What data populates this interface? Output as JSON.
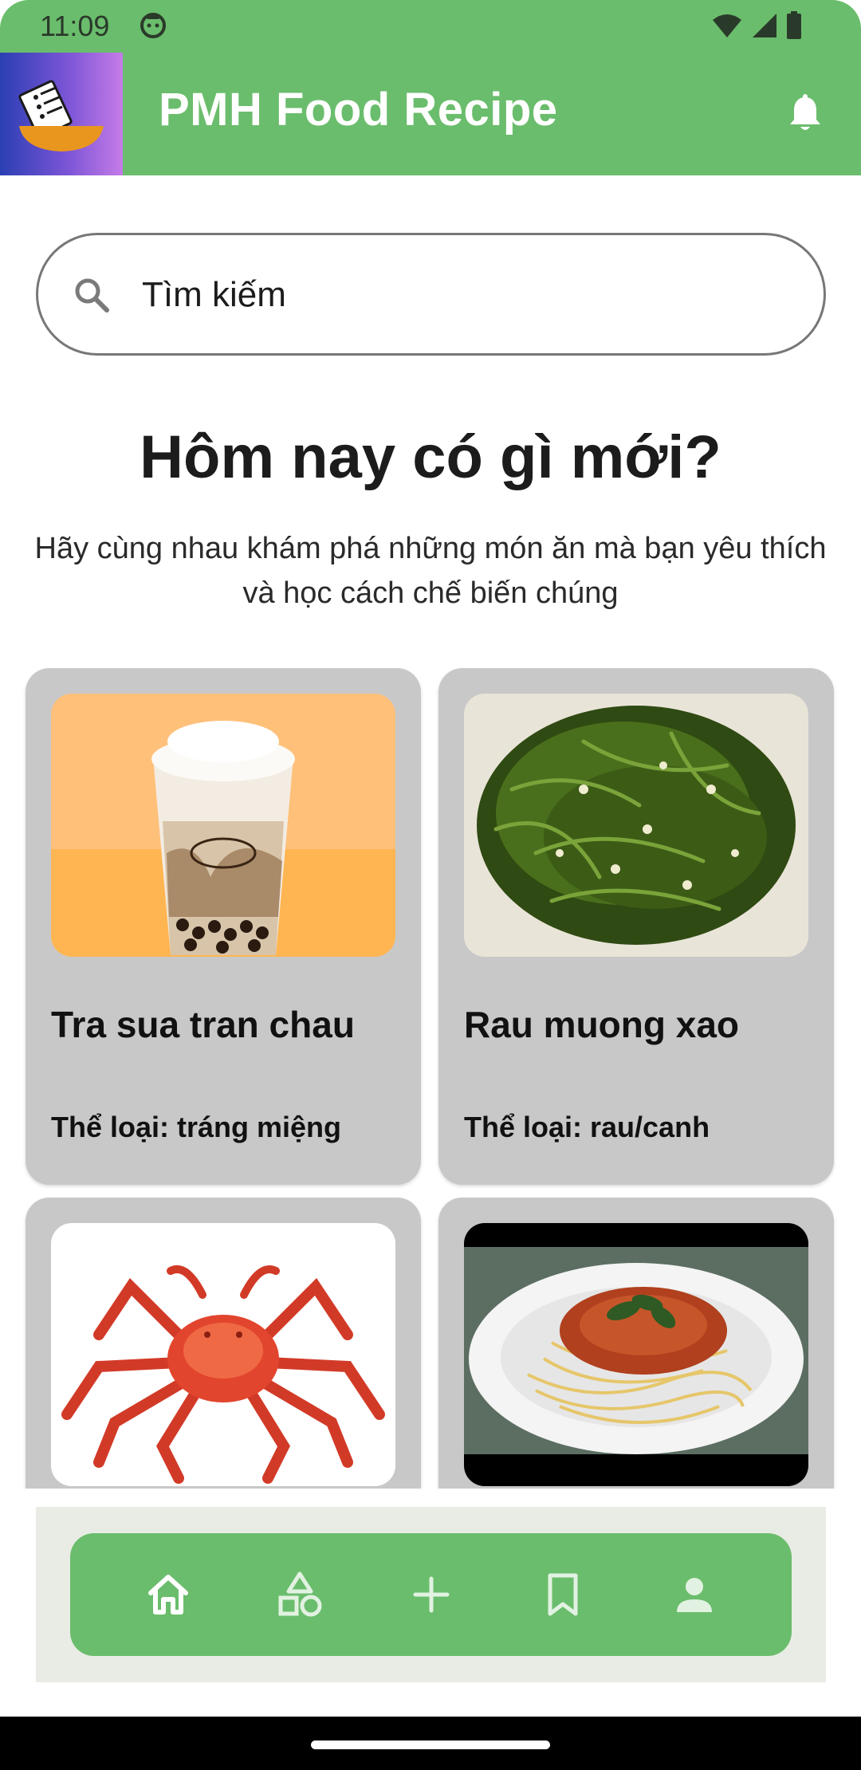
{
  "status_bar": {
    "time": "11:09",
    "icons": [
      "face-icon",
      "wifi-icon",
      "signal-icon",
      "battery-icon"
    ]
  },
  "app_bar": {
    "title": "PMH Food Recipe",
    "logo_icon": "recipe-bowl-logo",
    "notification_icon": "bell-icon"
  },
  "search": {
    "placeholder": "Tìm kiếm",
    "value": "",
    "icon": "search-icon"
  },
  "main": {
    "headline": "Hôm nay có gì mới?",
    "subtitle": "Hãy cùng nhau khám phá những món ăn mà bạn yêu thích và học cách chế biến chúng"
  },
  "recipes": [
    {
      "title": "Tra sua tran chau",
      "category": "Thể loại: tráng miệng",
      "image": "bubble-milk-tea"
    },
    {
      "title": "Rau muong xao",
      "category": "Thể loại: rau/canh",
      "image": "stir-fried-water-spinach"
    },
    {
      "title": "",
      "category": "",
      "image": "king-crab"
    },
    {
      "title": "",
      "category": "",
      "image": "spaghetti-bolognese"
    }
  ],
  "bottom_nav": {
    "items": [
      {
        "name": "home",
        "icon": "home-icon",
        "active": true
      },
      {
        "name": "categories",
        "icon": "categories-icon",
        "active": false
      },
      {
        "name": "add",
        "icon": "add-icon",
        "active": false
      },
      {
        "name": "bookmarks",
        "icon": "bookmark-icon",
        "active": false
      },
      {
        "name": "profile",
        "icon": "profile-icon",
        "active": false
      }
    ]
  },
  "colors": {
    "primary_green": "#6abd6c",
    "card_gray": "#c8c8c8",
    "nav_background": "#e8ece4"
  }
}
